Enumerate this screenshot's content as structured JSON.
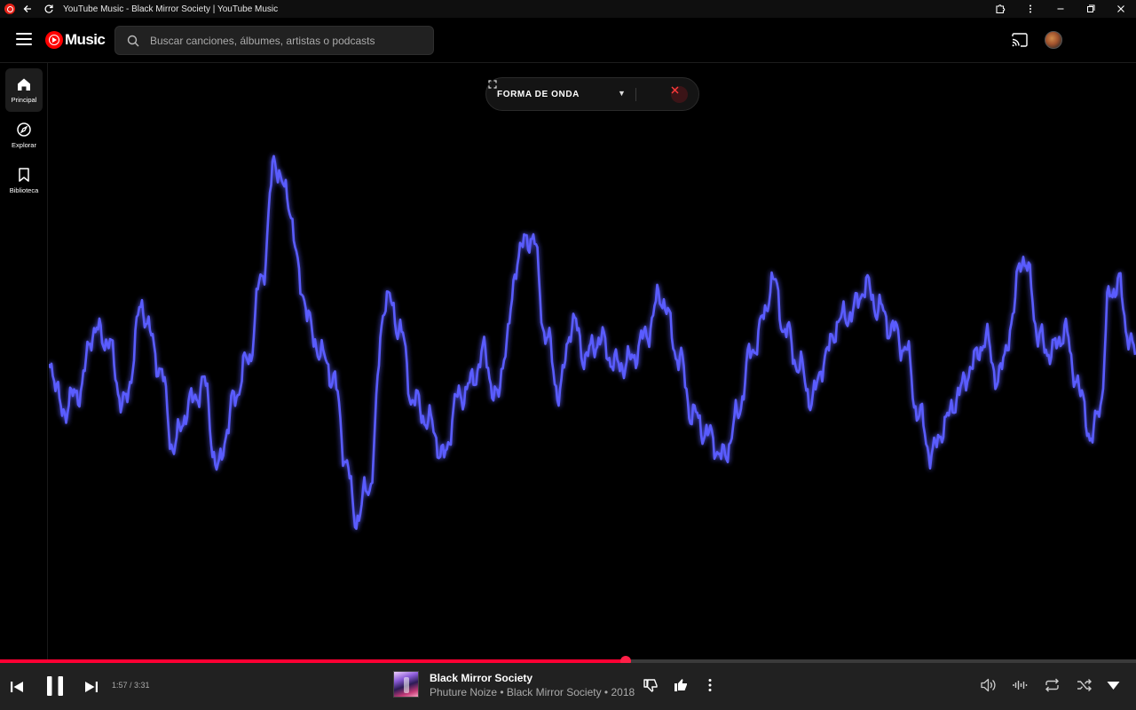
{
  "window": {
    "title": "YouTube Music - Black Mirror Society | YouTube Music"
  },
  "topnav": {
    "logo_text": "Music",
    "search_placeholder": "Buscar canciones, álbumes, artistas o podcasts"
  },
  "sidebar": {
    "items": [
      {
        "label": "Principal",
        "icon": "home-icon",
        "active": true
      },
      {
        "label": "Explorar",
        "icon": "compass-icon",
        "active": false
      },
      {
        "label": "Biblioteca",
        "icon": "bookmark-icon",
        "active": false
      }
    ]
  },
  "visualizer": {
    "mode_label": "FORMA DE ONDA",
    "line_color": "#5a5cff"
  },
  "player": {
    "time": "1:57 / 3:31",
    "progress": 0.551,
    "song_title": "Black Mirror Society",
    "song_subtitle": "Phuture Noize • Black Mirror Society • 2018"
  },
  "colors": {
    "accent": "#ff0033",
    "background": "#000000",
    "player_bg": "#212121"
  }
}
